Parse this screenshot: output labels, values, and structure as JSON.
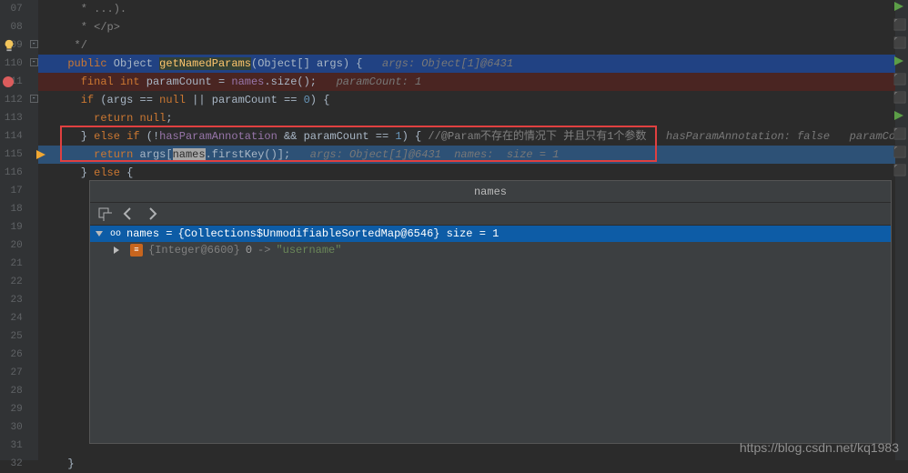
{
  "lines": {
    "l07": "      * ...).",
    "l08": "      * </p>",
    "l09": "     */",
    "l110_pre": "    ",
    "l110_kw1": "public",
    "l110_sp1": " ",
    "l110_type1": "Object",
    "l110_sp2": " ",
    "l110_method": "getNamedParams",
    "l110_rest": "(Object[] args) {   ",
    "l110_hint": "args: Object[1]@6431",
    "l111_pre": "      ",
    "l111_kw1": "final int",
    "l111_mid": " paramCount = ",
    "l111_field": "names",
    "l111_rest": ".size();   ",
    "l111_hint": "paramCount: 1",
    "l112_pre": "      ",
    "l112_kw1": "if",
    "l112_mid1": " (args == ",
    "l112_kw2": "null",
    "l112_mid2": " || paramCount == ",
    "l112_num": "0",
    "l112_rest": ") {",
    "l113_pre": "        ",
    "l113_kw": "return null",
    "l113_rest": ";",
    "l114_pre": "      } ",
    "l114_kw1": "else if",
    "l114_mid1": " (!",
    "l114_field1": "hasParamAnnotation",
    "l114_mid2": " && paramCount == ",
    "l114_num": "1",
    "l114_mid3": ") { ",
    "l114_comment": "//@Param不存在的情况下 并且只有1个参数",
    "l114_hint": "   hasParamAnnotation: false   paramCo",
    "l115_pre": "        ",
    "l115_kw": "return",
    "l115_mid1": " args[",
    "l115_sel": "names",
    "l115_mid2": ".firstKey()];   ",
    "l115_hint": "args: Object[1]@6431  names:  size = 1",
    "l116_pre": "      } ",
    "l116_kw": "else",
    "l116_rest": " {",
    "l132_pre": "    }"
  },
  "gutter": [
    "07",
    "08",
    "09",
    "110",
    "111",
    "112",
    "113",
    "114",
    "115",
    "116",
    "17",
    "18",
    "19",
    "20",
    "21",
    "22",
    "23",
    "24",
    "25",
    "26",
    "27",
    "28",
    "29",
    "30",
    "31",
    "32"
  ],
  "debug": {
    "title": "names",
    "root_pre": "names = ",
    "root_val": "{Collections$UnmodifiableSortedMap@6546}  size = 1",
    "child_pre": "{Integer@6600} ",
    "child_key": "0",
    "child_arrow": " -> ",
    "child_val": "\"username\""
  },
  "watermark": "https://blog.csdn.net/kq1983"
}
